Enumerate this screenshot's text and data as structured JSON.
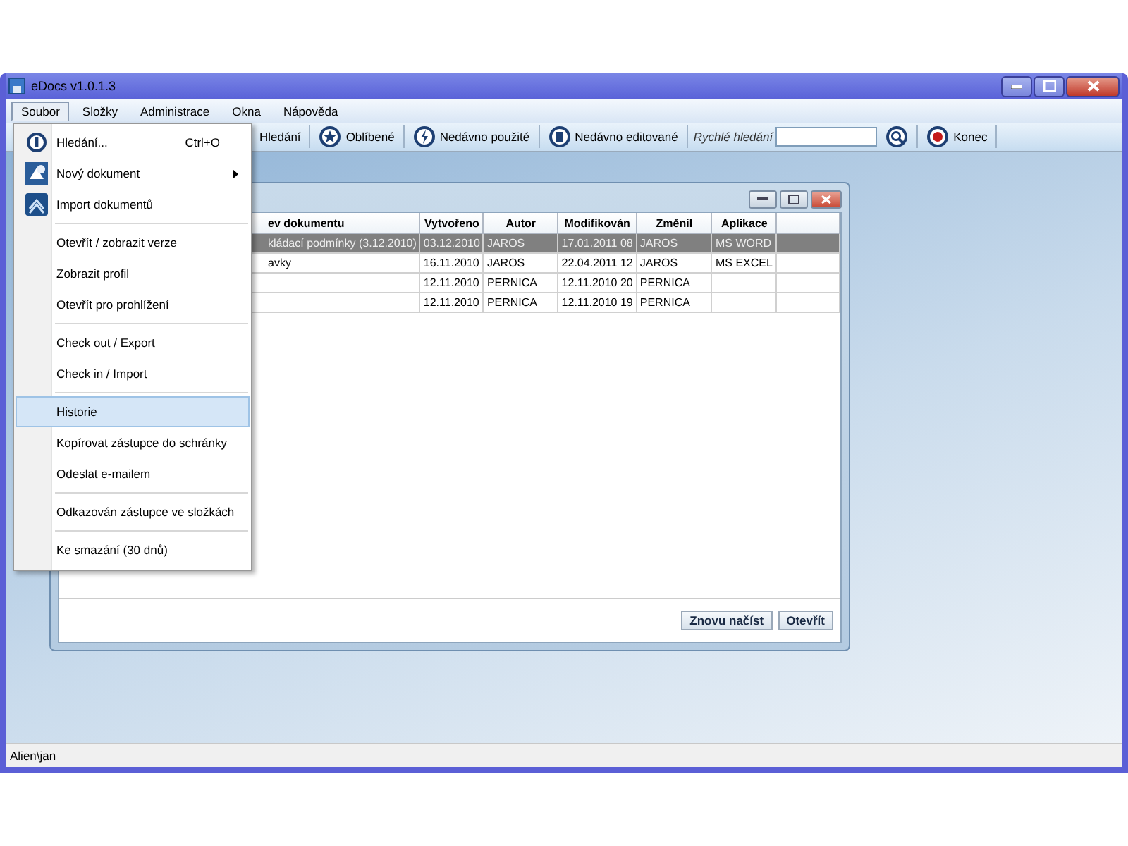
{
  "window": {
    "title": "eDocs v1.0.1.3"
  },
  "menu_bar": [
    {
      "label": "Soubor",
      "selected": true
    },
    {
      "label": "Složky",
      "selected": false
    },
    {
      "label": "Administrace",
      "selected": false
    },
    {
      "label": "Okna",
      "selected": false
    },
    {
      "label": "Nápověda",
      "selected": false
    }
  ],
  "toolbar": [
    {
      "kind": "button",
      "label": "Hledání"
    },
    {
      "kind": "button",
      "label": "Oblíbené"
    },
    {
      "kind": "button",
      "label": "Nedávno použité"
    },
    {
      "kind": "button",
      "label": "Nedávno editované"
    },
    {
      "kind": "search",
      "label": "Rychlé hledání"
    },
    {
      "kind": "search-button"
    },
    {
      "kind": "button",
      "label": "Konec"
    }
  ],
  "dropdown": [
    [
      {
        "kind": "icon",
        "label": "Hledání...",
        "shortcut": "Ctrl+O",
        "submenu": false,
        "selected": false
      },
      {
        "kind": "icon",
        "label": "Nový dokument",
        "submenu": true,
        "selected": false
      },
      {
        "kind": "icon",
        "label": "Import dokumentů",
        "submenu": false,
        "selected": false
      }
    ],
    [
      {
        "kind": "plain",
        "label": "Otevřít / zobrazit verze",
        "submenu": false,
        "selected": false
      },
      {
        "kind": "plain",
        "label": "Zobrazit profil",
        "submenu": false,
        "selected": false
      },
      {
        "kind": "plain",
        "label": "Otevřít pro prohlížení",
        "submenu": false,
        "selected": false
      }
    ],
    [
      {
        "kind": "plain",
        "label": "Check out / Export",
        "submenu": false,
        "selected": false
      },
      {
        "kind": "plain",
        "label": "Check in / Import",
        "submenu": false,
        "selected": false
      }
    ],
    [
      {
        "kind": "plain",
        "label": "Historie",
        "submenu": false,
        "selected": true
      },
      {
        "kind": "plain",
        "label": "Kopírovat zástupce do schránky",
        "submenu": false,
        "selected": false
      },
      {
        "kind": "plain",
        "label": "Odeslat e-mailem",
        "submenu": false,
        "selected": false
      }
    ],
    [
      {
        "kind": "plain",
        "label": "Odkazován zástupce ve složkách",
        "submenu": false,
        "selected": false
      }
    ],
    [
      {
        "kind": "plain",
        "label": "Ke smazání (30 dnů)",
        "submenu": false,
        "selected": false
      }
    ]
  ],
  "child_window": {
    "table": {
      "columns": [
        "ev dokumentu",
        "Vytvořeno",
        "Autor",
        "Modifikován",
        "Změnil",
        "Aplikace"
      ],
      "rows": [
        {
          "selected": true,
          "cells": [
            "kládací podmínky (3.12.2010)",
            "03.12.2010",
            "JAROS",
            "17.01.2011 08",
            "JAROS",
            "MS WORD"
          ]
        },
        {
          "selected": false,
          "cells": [
            "avky",
            "16.11.2010",
            "JAROS",
            "22.04.2011 12",
            "JAROS",
            "MS EXCEL"
          ]
        },
        {
          "selected": false,
          "cells": [
            "",
            "12.11.2010",
            "PERNICA",
            "12.11.2010 20",
            "PERNICA",
            ""
          ]
        },
        {
          "selected": false,
          "cells": [
            "",
            "12.11.2010",
            "PERNICA",
            "12.11.2010 19",
            "PERNICA",
            ""
          ]
        }
      ]
    },
    "buttons": [
      "Znovu načíst",
      "Otevřít"
    ]
  },
  "status_bar": {
    "text": "Alien\\jan"
  }
}
